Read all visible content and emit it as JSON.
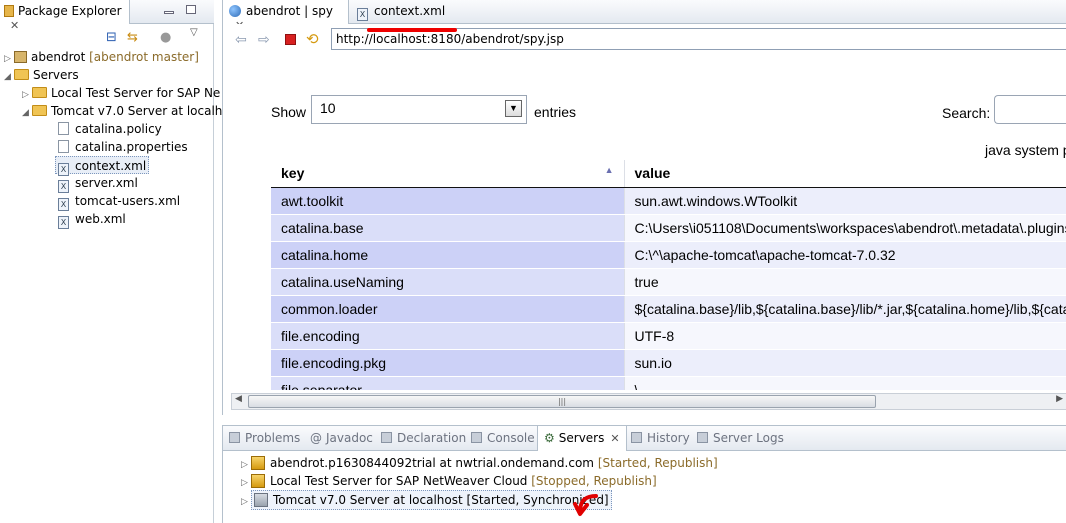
{
  "left_panel": {
    "tab_title": "Package Explorer",
    "tree": [
      {
        "label": "abendrot",
        "meta": "[abendrot master]"
      },
      {
        "label": "Servers"
      },
      {
        "label": "Local Test Server for SAP Ne"
      },
      {
        "label": "Tomcat v7.0 Server at localh"
      },
      {
        "label": "catalina.policy"
      },
      {
        "label": "catalina.properties"
      },
      {
        "label": "context.xml"
      },
      {
        "label": "server.xml"
      },
      {
        "label": "tomcat-users.xml"
      },
      {
        "label": "web.xml"
      }
    ]
  },
  "editor": {
    "tabs": [
      "abendrot | spy",
      "context.xml"
    ],
    "url": "http://localhost:8180/abendrot/spy.jsp",
    "show_label": "Show",
    "entries_select": "10",
    "entries_label": "entries",
    "search_label": "Search:",
    "table_caption": "java system p",
    "columns": [
      "key",
      "value"
    ],
    "rows": [
      {
        "key": "awt.toolkit",
        "value": "sun.awt.windows.WToolkit"
      },
      {
        "key": "catalina.base",
        "value": "C:\\Users\\i051108\\Documents\\workspaces\\abendrot\\.metadata\\.plugins"
      },
      {
        "key": "catalina.home",
        "value": "C:\\^\\apache-tomcat\\apache-tomcat-7.0.32"
      },
      {
        "key": "catalina.useNaming",
        "value": "true"
      },
      {
        "key": "common.loader",
        "value": "${catalina.base}/lib,${catalina.base}/lib/*.jar,${catalina.home}/lib,${catal"
      },
      {
        "key": "file.encoding",
        "value": "UTF-8"
      },
      {
        "key": "file.encoding.pkg",
        "value": "sun.io"
      },
      {
        "key": "file.separator",
        "value": "\\"
      }
    ]
  },
  "bottom_panel": {
    "tabs": [
      "Problems",
      "Javadoc",
      "Declaration",
      "Console",
      "Servers",
      "History",
      "Server Logs"
    ],
    "active_tab": "Servers",
    "servers": [
      {
        "name": "abendrot.p1630844092trial at nwtrial.ondemand.com",
        "status": "[Started, Republish]"
      },
      {
        "name": "Local Test Server for SAP NetWeaver Cloud",
        "status": "[Stopped, Republish]"
      },
      {
        "name": "Tomcat v7.0 Server at localhost",
        "status": "[Started, Synchronized]"
      }
    ]
  },
  "colors": {
    "key_cell": "#ccd1f7",
    "annotation_red": "#e00000"
  }
}
